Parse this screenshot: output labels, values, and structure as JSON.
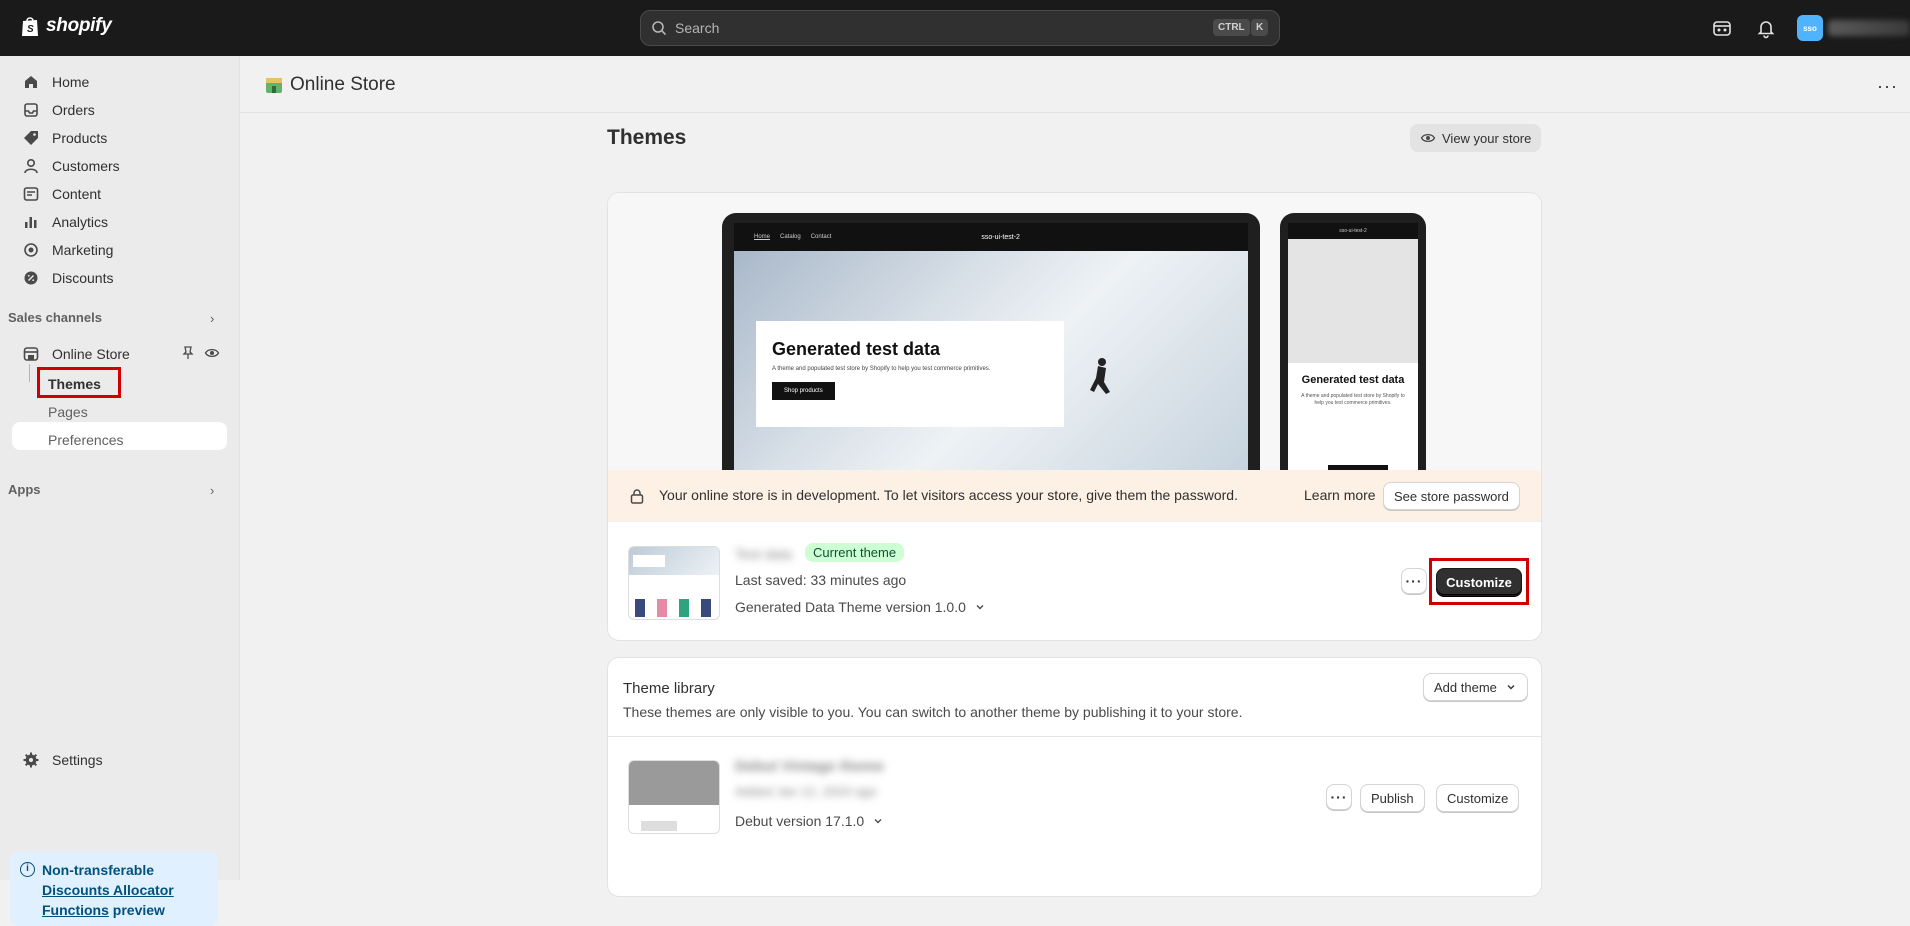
{
  "topbar": {
    "brand": "shopify",
    "search_placeholder": "Search",
    "shortcut_1": "CTRL",
    "shortcut_2": "K",
    "avatar_initials": "sso"
  },
  "sidebar": {
    "items": [
      {
        "label": "Home",
        "icon": "home-icon"
      },
      {
        "label": "Orders",
        "icon": "inbox-icon"
      },
      {
        "label": "Products",
        "icon": "tag-icon"
      },
      {
        "label": "Customers",
        "icon": "person-icon"
      },
      {
        "label": "Content",
        "icon": "content-icon"
      },
      {
        "label": "Analytics",
        "icon": "bar-chart-icon"
      },
      {
        "label": "Marketing",
        "icon": "target-icon"
      },
      {
        "label": "Discounts",
        "icon": "discount-icon"
      }
    ],
    "sales_channels_label": "Sales channels",
    "online_store_label": "Online Store",
    "sub_items": [
      "Themes",
      "Pages",
      "Preferences"
    ],
    "apps_label": "Apps",
    "settings_label": "Settings",
    "notice": {
      "part1": "Non-transferable ",
      "link": "Discounts Allocator Functions",
      "part2": " preview"
    }
  },
  "header": {
    "title": "Online Store",
    "more_label": "···"
  },
  "themes": {
    "title": "Themes",
    "view_store": "View your store"
  },
  "preview": {
    "store_name": "sso-ui-test-2",
    "nav_links": [
      "Home",
      "Catalog",
      "Contact"
    ],
    "hero_title": "Generated test data",
    "hero_sub": "A theme and populated test store by Shopify to help you test commerce primitives.",
    "hero_button": "Shop products",
    "phone_title": "Generated test data",
    "phone_sub": "A theme and populated test store by Shopify to help you test commerce primitives."
  },
  "dev_bar": {
    "message": "Your online store is in development. To let visitors access your store, give them the password.",
    "learn_more": "Learn more",
    "see_password": "See store password"
  },
  "current_theme": {
    "name": "Test data",
    "badge": "Current theme",
    "last_saved": "Last saved: 33 minutes ago",
    "version": "Generated Data Theme version 1.0.0",
    "more": "···",
    "customize": "Customize"
  },
  "library": {
    "title": "Theme library",
    "subtitle": "These themes are only visible to you. You can switch to another theme by publishing it to your store.",
    "add_theme": "Add theme",
    "theme": {
      "name": "Debut Vintage theme",
      "saved": "Added Jan 12, 2024 ago",
      "version": "Debut version 17.1.0",
      "more": "···",
      "publish": "Publish",
      "customize": "Customize"
    }
  },
  "colors": {
    "topbar": "#1a1a1a",
    "highlight": "#d00000",
    "badge_bg": "#cdfed4",
    "dev_bar": "#fcf1e4"
  }
}
